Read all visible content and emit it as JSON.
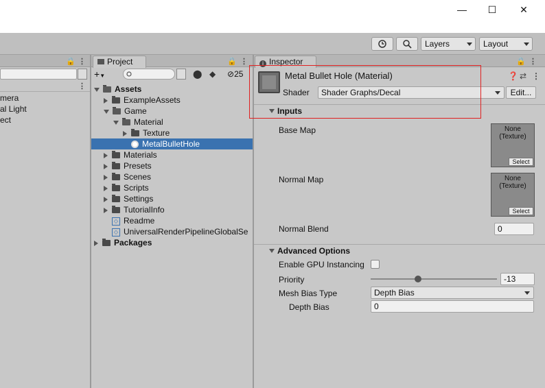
{
  "window": {
    "minimize": "—",
    "maximize": "☐",
    "close": "✕"
  },
  "toolbar": {
    "layers_label": "Layers",
    "layout_label": "Layout",
    "history_icon": "history-icon",
    "search_icon": "search-icon"
  },
  "hierarchy": {
    "items": [
      "mera",
      "al Light",
      "ect"
    ]
  },
  "project": {
    "tab_label": "Project",
    "hidden_count": "25",
    "tree": [
      {
        "label": "Assets"
      },
      {
        "label": "ExampleAssets"
      },
      {
        "label": "Game"
      },
      {
        "label": "Material"
      },
      {
        "label": "Texture"
      },
      {
        "label": "MetalBulletHole"
      },
      {
        "label": "Materials"
      },
      {
        "label": "Presets"
      },
      {
        "label": "Scenes"
      },
      {
        "label": "Scripts"
      },
      {
        "label": "Settings"
      },
      {
        "label": "TutorialInfo"
      },
      {
        "label": "Readme"
      },
      {
        "label": "UniversalRenderPipelineGlobalSe"
      },
      {
        "label": "Packages"
      }
    ]
  },
  "inspector": {
    "tab_label": "Inspector",
    "material_title": "Metal Bullet Hole (Material)",
    "shader_label": "Shader",
    "shader_value": "Shader Graphs/Decal",
    "edit_button": "Edit...",
    "inputs_section": "Inputs",
    "base_map_label": "Base Map",
    "normal_map_label": "Normal Map",
    "tex_none_1": "None",
    "tex_type_1": "(Texture)",
    "tex_select_1": "Select",
    "tex_none_2": "None",
    "tex_type_2": "(Texture)",
    "tex_select_2": "Select",
    "normal_blend_label": "Normal Blend",
    "normal_blend_value": "0",
    "advanced_section": "Advanced Options",
    "gpu_instancing_label": "Enable GPU Instancing",
    "priority_label": "Priority",
    "priority_value": "-13",
    "mesh_bias_type_label": "Mesh Bias Type",
    "mesh_bias_type_value": "Depth Bias",
    "depth_bias_label": "Depth Bias",
    "depth_bias_value": "0"
  },
  "colors": {
    "selection": "#3a72b0",
    "highlight_box": "#e02020"
  }
}
